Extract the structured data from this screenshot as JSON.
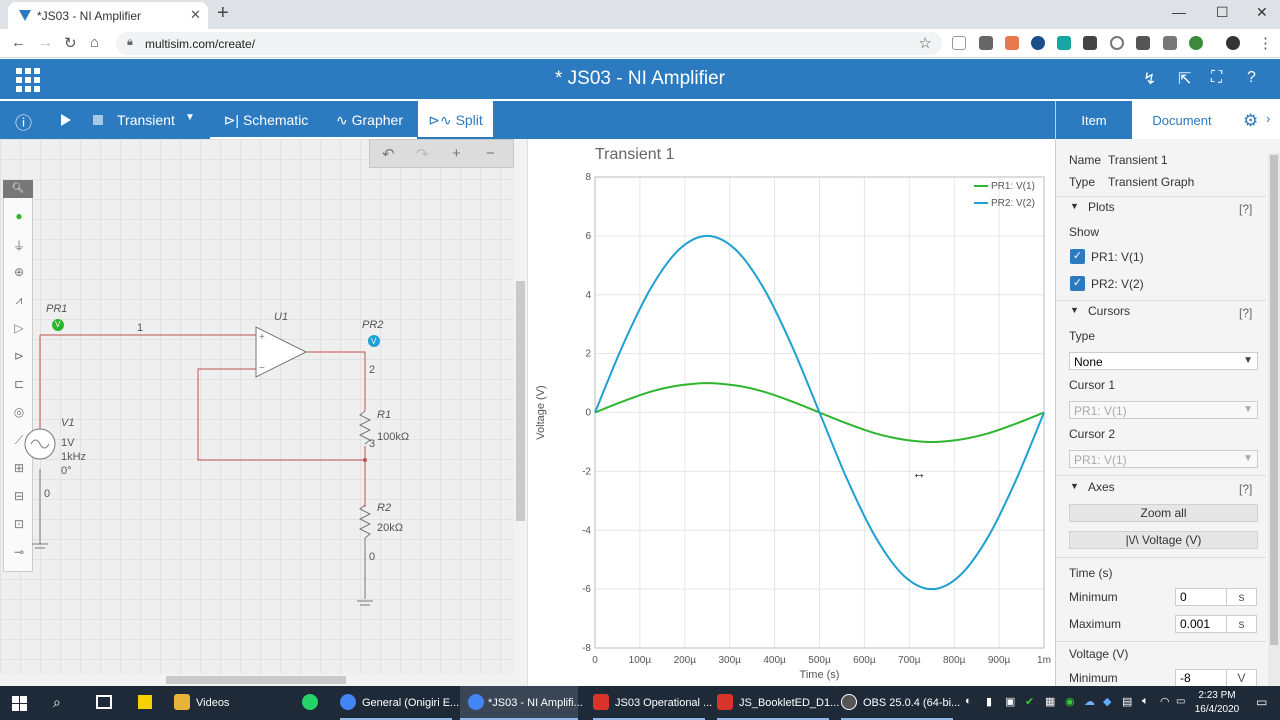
{
  "browser": {
    "tab_title": "*JS03 - NI Amplifier",
    "tab_close": "✕",
    "new_tab": "+",
    "url": "multisim.com/create/",
    "window_controls": [
      "—",
      "☐",
      "✕"
    ]
  },
  "app": {
    "title": "* JS03 - NI Amplifier",
    "header_icons": [
      "assistant-icon",
      "open-external-icon",
      "fullscreen-icon",
      "help-icon"
    ]
  },
  "toolbar": {
    "info": "ⓘ",
    "analysis": "Transient",
    "tabs": {
      "schematic": "Schematic",
      "grapher": "Grapher",
      "split": "Split"
    },
    "active_tab": "Split"
  },
  "schematic": {
    "labels": {
      "pr1": "PR1",
      "pr1_tag": "V",
      "pr2": "PR2",
      "pr2_tag": "V",
      "u1": "U1",
      "net1": "1",
      "net2": "2",
      "net3": "3",
      "net0_left": "0",
      "net0_right": "0",
      "r1": "R1",
      "r1_val": "100kΩ",
      "r2": "R2",
      "r2_val": "20kΩ",
      "v1": "V1",
      "v1_amp": "1V",
      "v1_freq": "1kHz",
      "v1_phase": "0°"
    }
  },
  "grapher": {
    "title": "Transient 1"
  },
  "chart_data": {
    "type": "line",
    "title": "Transient 1",
    "xlabel": "Time (s)",
    "ylabel": "Voltage (V)",
    "xlim": [
      0,
      0.001
    ],
    "ylim": [
      -8,
      8
    ],
    "x_tick_labels": [
      "0",
      "100µ",
      "200µ",
      "300µ",
      "400µ",
      "500µ",
      "600µ",
      "700µ",
      "800µ",
      "900µ",
      "1m"
    ],
    "y_tick_labels": [
      "-8",
      "-6",
      "-4",
      "-2",
      "0",
      "2",
      "4",
      "6",
      "8"
    ],
    "y_ticks": [
      -8,
      -6,
      -4,
      -2,
      0,
      2,
      4,
      6,
      8
    ],
    "grid": true,
    "legend_position": "top-right",
    "series": [
      {
        "name": "PR1: V(1)",
        "color": "#2db52d",
        "x": [
          0,
          6.25e-05,
          0.000125,
          0.0001875,
          0.00025,
          0.0003125,
          0.000375,
          0.0004375,
          0.0005,
          0.0005625,
          0.000625,
          0.0006875,
          0.00075,
          0.0008125,
          0.000875,
          0.0009375,
          0.001
        ],
        "y": [
          0,
          0.38,
          0.71,
          0.92,
          1.0,
          0.92,
          0.71,
          0.38,
          0,
          -0.38,
          -0.71,
          -0.92,
          -1.0,
          -0.92,
          -0.71,
          -0.38,
          0
        ]
      },
      {
        "name": "PR2: V(2)",
        "color": "#1ea0d2",
        "x": [
          0,
          6.25e-05,
          0.000125,
          0.0001875,
          0.00025,
          0.0003125,
          0.000375,
          0.0004375,
          0.0005,
          0.0005625,
          0.000625,
          0.0006875,
          0.00075,
          0.0008125,
          0.000875,
          0.0009375,
          0.001
        ],
        "y": [
          0,
          2.3,
          4.24,
          5.54,
          6.0,
          5.54,
          4.24,
          2.3,
          0,
          -2.3,
          -4.24,
          -5.54,
          -6.0,
          -5.54,
          -4.24,
          -2.3,
          0
        ]
      }
    ]
  },
  "panel": {
    "tabs": {
      "item": "Item",
      "document": "Document"
    },
    "name_label": "Name",
    "name_value": "Transient 1",
    "type_label": "Type",
    "type_value": "Transient Graph",
    "plots_section": "Plots",
    "help": "[?]",
    "show_label": "Show",
    "plots": [
      {
        "label": "PR1: V(1)",
        "checked": true
      },
      {
        "label": "PR2: V(2)",
        "checked": true
      }
    ],
    "cursors_section": "Cursors",
    "cursor_type_label": "Type",
    "cursor_type_value": "None",
    "cursor1_label": "Cursor 1",
    "cursor1_value": "PR1: V(1)",
    "cursor2_label": "Cursor 2",
    "cursor2_value": "PR1: V(1)",
    "axes_section": "Axes",
    "zoom_all": "Zoom all",
    "voltage_btn": "|\\/\\ Voltage (V)",
    "time_label": "Time (s)",
    "min_label": "Minimum",
    "min_value": "0",
    "max_label": "Maximum",
    "max_value": "0.001",
    "time_unit": "s",
    "voltage_label": "Voltage (V)",
    "vmin_label": "Minimum",
    "vmin_value": "-8",
    "voltage_unit": "V"
  },
  "taskbar": {
    "apps": [
      {
        "label": "Videos",
        "color": "#e8b33a"
      },
      {
        "label": "General (Onigiri E...",
        "color": "#4285f4"
      },
      {
        "label": "*JS03 - NI Amplifi...",
        "color": "#4285f4"
      },
      {
        "label": "JS03 Operational ...",
        "color": "#d9342b"
      },
      {
        "label": "JS_BookletED_D1...",
        "color": "#d9342b"
      },
      {
        "label": "OBS 25.0.4 (64-bi...",
        "color": "#555555"
      }
    ],
    "time": "2:23 PM",
    "date": "16/4/2020"
  }
}
